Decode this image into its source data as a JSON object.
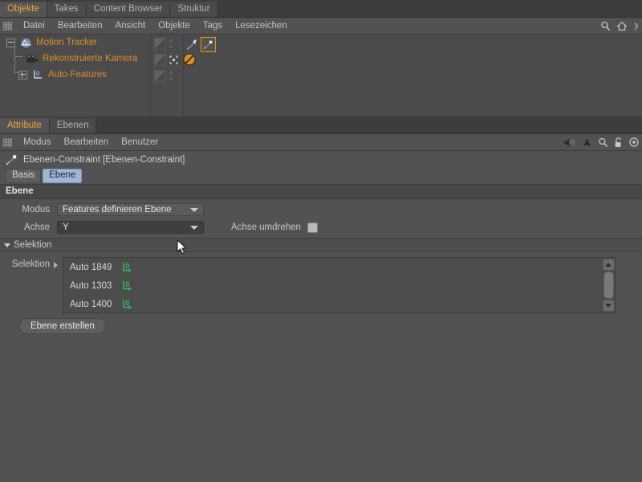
{
  "object_manager": {
    "tabs": [
      {
        "label": "Objekte",
        "active": true
      },
      {
        "label": "Takes",
        "active": false
      },
      {
        "label": "Content Browser",
        "active": false
      },
      {
        "label": "Struktur",
        "active": false
      }
    ],
    "menu": [
      "Datei",
      "Bearbeiten",
      "Ansicht",
      "Objekte",
      "Tags",
      "Lesezeichen"
    ],
    "toolbar_icons": [
      "search-icon",
      "home-icon"
    ],
    "tree": [
      {
        "label": "Motion Tracker",
        "icon": "motion-tracker-icon",
        "depth": 0,
        "expander": "minus"
      },
      {
        "label": "Rekonstruierte Kamera",
        "icon": "camera-icon",
        "depth": 1,
        "expander": "none"
      },
      {
        "label": "Auto-Features",
        "icon": "auto-features-icon",
        "depth": 1,
        "expander": "plus"
      }
    ],
    "tags": {
      "motion_tracker": [
        "motion-tracker-tag-icon",
        "ebenen-constraint-tag-icon"
      ],
      "camera": [
        "protection-tag-icon"
      ]
    },
    "text_color": "#e08b28"
  },
  "attribute_manager": {
    "tabs": [
      {
        "label": "Attribute",
        "active": true
      },
      {
        "label": "Ebenen",
        "active": false
      }
    ],
    "menu": [
      "Modus",
      "Bearbeiten",
      "Benutzer"
    ],
    "toolbar_icons": [
      "back-arrow-icon",
      "up-arrow-icon",
      "search-icon",
      "lock-icon",
      "circle-icon"
    ],
    "title": "Ebenen-Constraint [Ebenen-Constraint]",
    "title_icon": "ebenen-constraint-icon",
    "object_tabs": [
      {
        "label": "Basis",
        "active": false
      },
      {
        "label": "Ebene",
        "active": true
      }
    ],
    "group_title": "Ebene",
    "properties": {
      "modus_label": "Modus",
      "modus_value": "Features definieren Ebene",
      "achse_label": "Achse",
      "achse_value": "Y",
      "achse_umdrehen_label": "Achse umdrehen",
      "achse_umdrehen_checked": false
    },
    "selection_section": {
      "header": "Selektion",
      "field_label": "Selektion",
      "items": [
        {
          "label": "Auto 1849",
          "icon": "feature-axis-icon"
        },
        {
          "label": "Auto 1303",
          "icon": "feature-axis-icon"
        },
        {
          "label": "Auto 1400",
          "icon": "feature-axis-icon"
        }
      ]
    },
    "create_button": "Ebene erstellen",
    "accent_color": "#9fb6d8"
  }
}
